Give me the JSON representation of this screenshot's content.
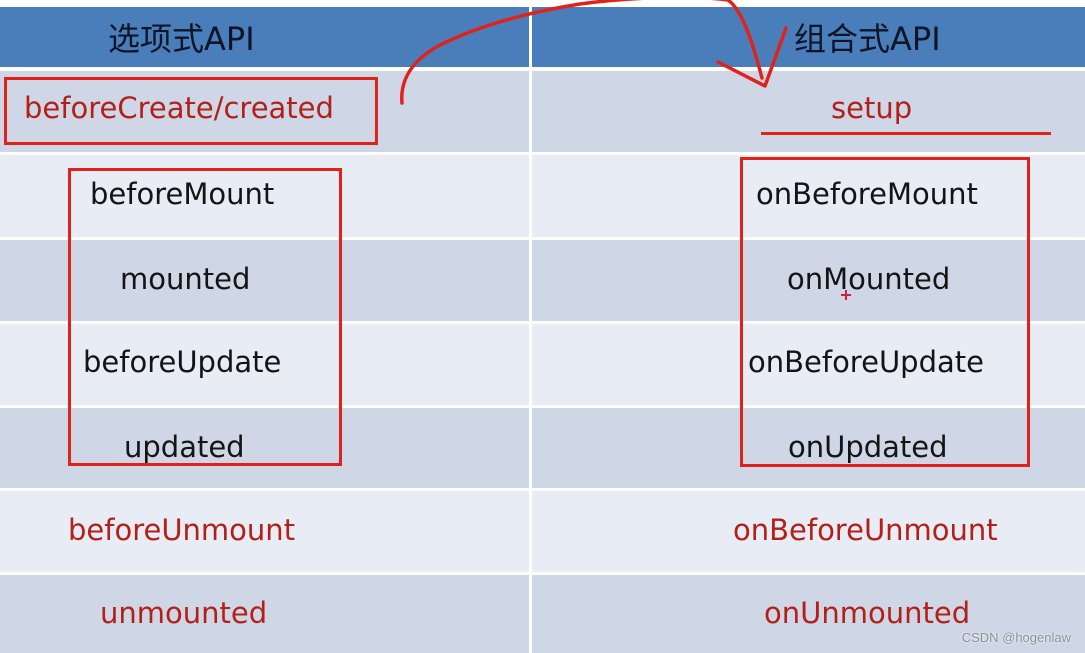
{
  "table": {
    "headers": [
      "选项式API",
      "组合式API"
    ],
    "rows": [
      {
        "options_api": "beforeCreate/created",
        "composition_api": "setup",
        "highlight": "red"
      },
      {
        "options_api": "beforeMount",
        "composition_api": "onBeforeMount",
        "highlight": "black"
      },
      {
        "options_api": "mounted",
        "composition_api": "onMounted",
        "highlight": "black"
      },
      {
        "options_api": "beforeUpdate",
        "composition_api": "onBeforeUpdate",
        "highlight": "black"
      },
      {
        "options_api": "updated",
        "composition_api": "onUpdated",
        "highlight": "black"
      },
      {
        "options_api": "beforeUnmount",
        "composition_api": "onBeforeUnmount",
        "highlight": "red"
      },
      {
        "options_api": "unmounted",
        "composition_api": "onUnmounted",
        "highlight": "red"
      }
    ]
  },
  "colors": {
    "header_bg": "#4a7ebb",
    "row_dark": "#cfd7e6",
    "row_light": "#e8ecf5",
    "annotation_red": "#e0221b",
    "text_red": "#b3201a",
    "text_black": "#141414"
  },
  "annotations": {
    "arrow": "beforeCreate/created → setup",
    "boxes": [
      "options-mount-update-group",
      "composition-mount-update-group",
      "beforeCreate-created-box"
    ],
    "underline": "setup"
  },
  "watermark": "CSDN @hogenlaw"
}
